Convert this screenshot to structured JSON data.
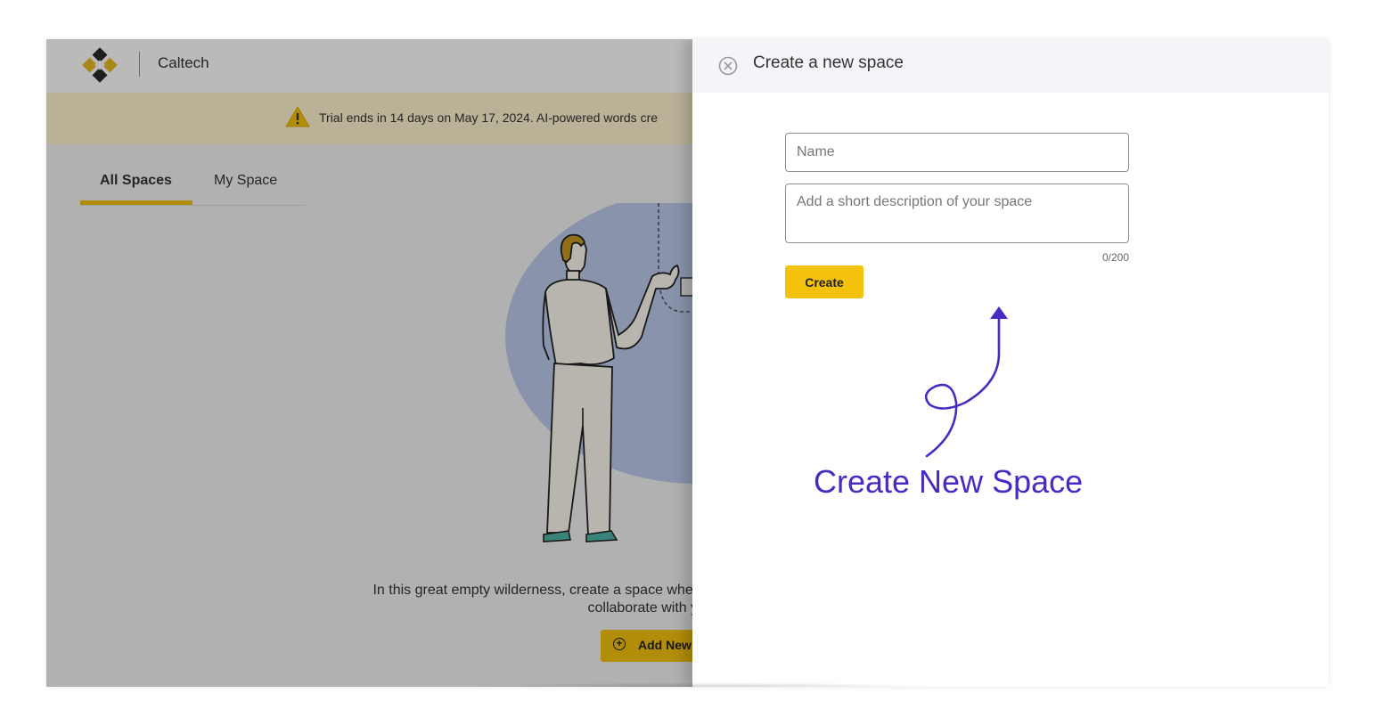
{
  "app": {
    "org_name": "Caltech",
    "trial_banner": "Trial ends in 14 days on May 17, 2024. AI-powered words cre",
    "tabs": [
      {
        "label": "All Spaces",
        "active": true
      },
      {
        "label": "My Space",
        "active": false
      }
    ],
    "empty_state": {
      "line1": "In this great empty wilderness, create a space where",
      "line2": "collaborate with yo"
    },
    "add_button_label": "Add New",
    "add_button_icon": "plus-circle-icon"
  },
  "drawer": {
    "title": "Create a new space",
    "close_icon": "close-circle-icon",
    "name_placeholder": "Name",
    "name_value": "",
    "description_placeholder": "Add a short description of your space",
    "description_value": "",
    "char_count": "0/200",
    "create_label": "Create"
  },
  "annotation": {
    "text": "Create New Space",
    "color": "#4a2bc2"
  },
  "colors": {
    "accent": "#f4c20d",
    "overlay": "rgba(0,0,0,0.27)",
    "annotation": "#4a2bc2"
  }
}
